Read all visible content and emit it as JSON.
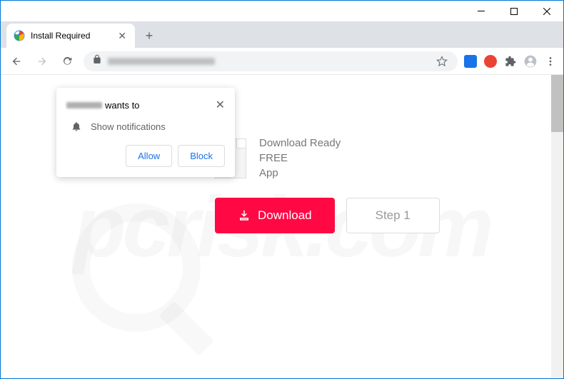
{
  "window": {
    "tab_title": "Install Required"
  },
  "permission": {
    "wants_to": "wants to",
    "show_notifications": "Show notifications",
    "allow": "Allow",
    "block": "Block"
  },
  "page": {
    "line1": "Download Ready",
    "line2": "FREE",
    "line3": "App",
    "download_btn": "Download",
    "step_btn": "Step 1"
  },
  "watermark": "pcrisk.com"
}
